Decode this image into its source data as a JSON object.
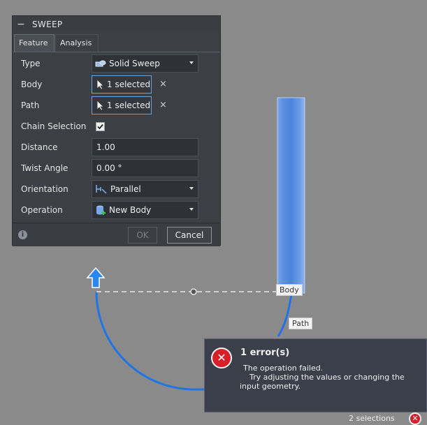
{
  "dialog": {
    "title": "SWEEP",
    "tabs": [
      "Feature",
      "Analysis"
    ],
    "type_label": "Type",
    "type_value": "Solid Sweep",
    "body_label": "Body",
    "body_value": "1 selected",
    "path_label": "Path",
    "path_value": "1 selected",
    "chain_label": "Chain Selection",
    "chain_checked": true,
    "distance_label": "Distance",
    "distance_value": "1.00",
    "twist_label": "Twist Angle",
    "twist_value": "0.00 °",
    "orientation_label": "Orientation",
    "orientation_value": "Parallel",
    "operation_label": "Operation",
    "operation_value": "New Body",
    "ok_label": "OK",
    "cancel_label": "Cancel",
    "clear_glyph": "×",
    "check_glyph": "✓"
  },
  "canvas": {
    "body_tag": "Body",
    "path_tag": "Path"
  },
  "error": {
    "title": "1 error(s)",
    "message": "The operation failed.",
    "detail": "Try adjusting the values or changing the input geometry."
  },
  "status": {
    "text": "2 selections"
  },
  "colors": {
    "sweep_body": "#5b8fe0",
    "path_curve": "#1f74e6",
    "error_red": "#d9202a",
    "selection_border": "#6da3d9"
  }
}
